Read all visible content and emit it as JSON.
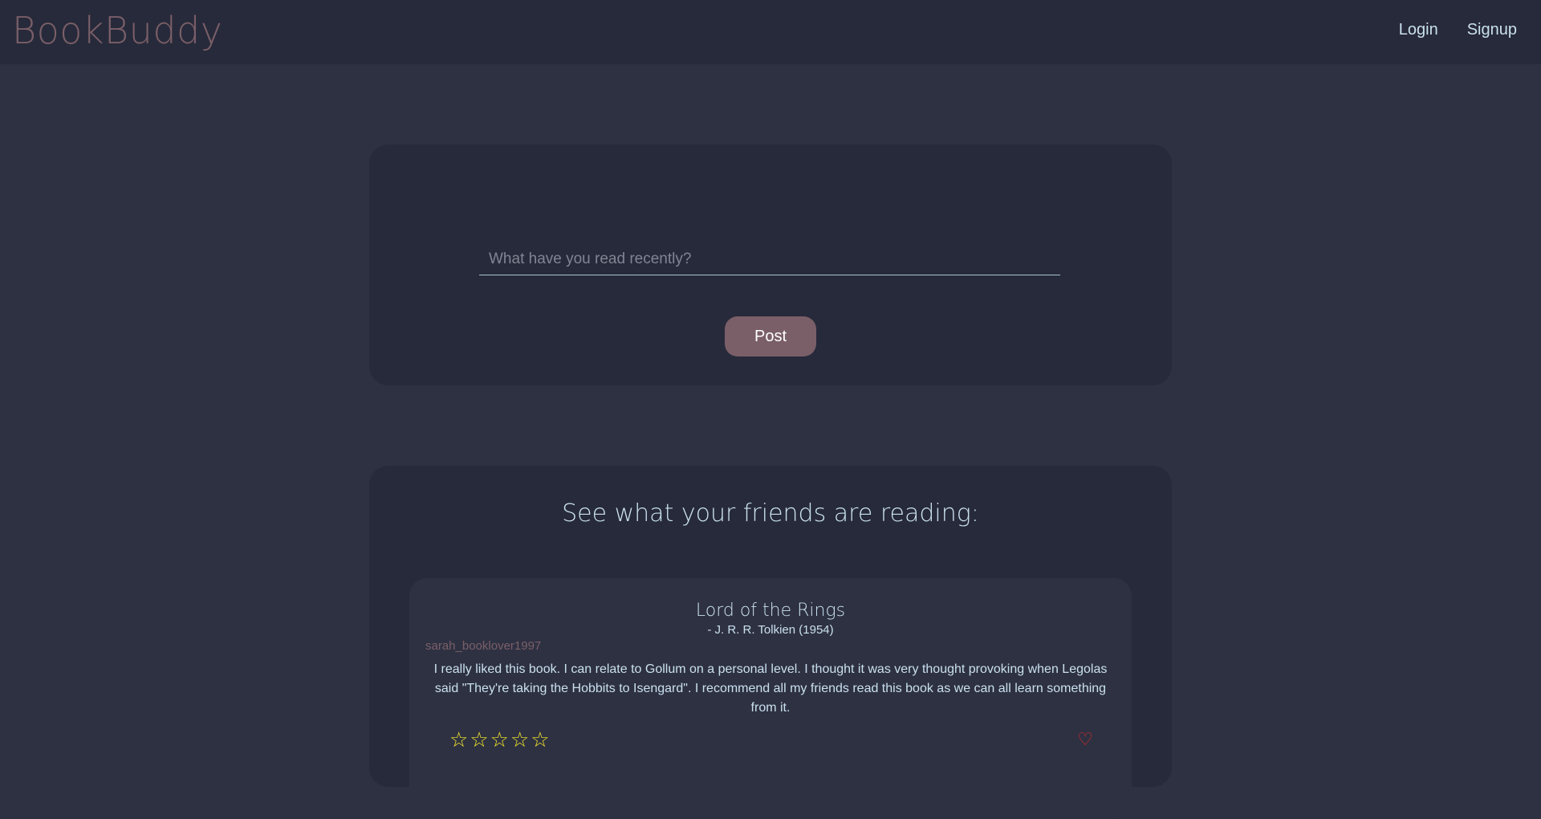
{
  "brand": "BookBuddy",
  "nav": {
    "login": "Login",
    "signup": "Signup"
  },
  "post_form": {
    "placeholder": "What have you read recently?",
    "post_label": "Post"
  },
  "feed": {
    "title": "See what your friends are reading:",
    "reviews": [
      {
        "book_title": "Lord of the Rings",
        "author": "- J. R. R. Tolkien (1954)",
        "username": "sarah_booklover1997",
        "text": "I really liked this book. I can relate to Gollum on a personal level. I thought it was very thought provoking when Legolas said \"They're taking the Hobbits to Isengard\". I recommend all my friends read this book as we can all learn something from it.",
        "stars": [
          "☆",
          "☆",
          "☆",
          "☆",
          "☆"
        ],
        "like_icon": "♡"
      }
    ]
  },
  "colors": {
    "background": "#2e3142",
    "card": "#272a3a",
    "accent": "#7a5f68",
    "text": "#c9e0ee",
    "star": "#f2e52c",
    "like": "#e02626"
  }
}
